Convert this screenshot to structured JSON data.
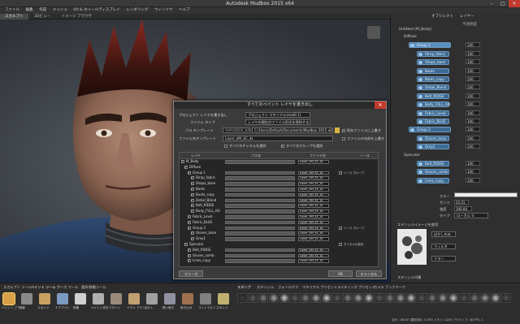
{
  "window": {
    "title": "Autodesk Mudbox 2015 x64",
    "min": "–",
    "max": "□",
    "close": "✕"
  },
  "menu": [
    "ファイル",
    "編集",
    "作成",
    "メッシュ",
    "UV & ホイールディスプレイ",
    "レンダリング",
    "ウィンドウ",
    "ヘルプ"
  ],
  "view_tabs": [
    "スカルプト",
    "3Dビュー",
    "イメージ ブラウザ"
  ],
  "right_panel": {
    "tabs": [
      "オブジェクト",
      "レイヤー"
    ],
    "col_header": "不透明度",
    "root": "Untitled (M_Body)",
    "items": [
      {
        "label": "Diffuse",
        "value": ""
      },
      {
        "label": "Group 1",
        "value": "100"
      },
      {
        "label": "Strap_fabric",
        "value": "100"
      },
      {
        "label": "Shape_base",
        "value": "100"
      },
      {
        "label": "Boots",
        "value": "100"
      },
      {
        "label": "Boots_copy",
        "value": "100"
      },
      {
        "label": "Detail_Blend",
        "value": "100"
      },
      {
        "label": "Belt_RIDGE",
        "value": "100"
      },
      {
        "label": "Body_FULL_AO",
        "value": "100"
      },
      {
        "label": "Fabric_Level",
        "value": "100"
      },
      {
        "label": "Fabric_BLUE",
        "value": "100"
      },
      {
        "label": "Group 2",
        "value": "100"
      },
      {
        "label": "Gloves_base",
        "value": "100"
      },
      {
        "label": "Grey1",
        "value": "100"
      },
      {
        "label": "Specular",
        "value": ""
      },
      {
        "label": "Belt_RIDGE",
        "value": "100"
      },
      {
        "label": "Gloves_comb",
        "value": "100"
      },
      {
        "label": "Lines_copy",
        "value": "100"
      }
    ],
    "props": {
      "color_label": "カラー",
      "gamma_label": "ガンマ",
      "gamma_value": "25.01",
      "opacity_label": "強度",
      "opacity_value": "100.00",
      "type_label": "タイプ",
      "type_value": "ローカル ①",
      "stencil_header": "ステンシルイメージを使用",
      "stencil_fields": [
        "ぼかしのみ",
        "フィルタ",
        "ミラー"
      ],
      "shortcut_header": "ステンシル付属"
    }
  },
  "dialog": {
    "title": "すべてのペイント レイヤを書き出し",
    "mesh_label": "プロジェクト レイヤを書き出し",
    "mesh_value": "プロジェクト マテリアル(mat0 1)",
    "file_type_label": "ファイル タイプ",
    "file_type_value": "レイヤの現在のファイル形式を保持する",
    "path_label": "パス テンプレート",
    "path_prefix": "%MUDBOX_BASE%",
    "path_value": "C:/Users/Default/Documents/Mudbox 2015 x64/Ma",
    "name_label": "ファイル名テンプレート",
    "name_value": "Layer_$M_$C_$L",
    "opt1": "既存ファイルに上書き",
    "opt2": "ファイルの名前を上書き",
    "opt3": "すべてのチャネルを選択",
    "opt4": "すべてのグループを選択",
    "cols": [
      "レイヤ",
      "パス名",
      "ファイル名",
      "ソース"
    ],
    "dd_value": "Layer_$M_$C_$L",
    "extra_text": "チャネルの変化",
    "extra_text2": "ソース グループ",
    "rows": [
      {
        "name": "M_Body",
        "indent": 0,
        "checked": true
      },
      {
        "name": "Diffuse",
        "indent": 1,
        "checked": true
      },
      {
        "name": "Group 1",
        "indent": 2,
        "checked": true
      },
      {
        "name": "Strap_fabric",
        "indent": 3,
        "checked": true
      },
      {
        "name": "Shape_base",
        "indent": 3,
        "checked": true
      },
      {
        "name": "Boots",
        "indent": 3,
        "checked": true
      },
      {
        "name": "Boots_copy",
        "indent": 3,
        "checked": true
      },
      {
        "name": "Detail_Blend",
        "indent": 3,
        "checked": true
      },
      {
        "name": "Belt_RIDGE",
        "indent": 3,
        "checked": true
      },
      {
        "name": "Body_FULL_AO",
        "indent": 3,
        "checked": true
      },
      {
        "name": "Fabric_Level",
        "indent": 2,
        "checked": true
      },
      {
        "name": "Fabric_BLUE",
        "indent": 2,
        "checked": true
      },
      {
        "name": "Group 2",
        "indent": 2,
        "checked": true
      },
      {
        "name": "Gloves_base",
        "indent": 3,
        "checked": true
      },
      {
        "name": "Grey1",
        "indent": 3,
        "checked": true
      },
      {
        "name": "Specular",
        "indent": 1,
        "checked": true
      },
      {
        "name": "Belt_RIDGE",
        "indent": 2,
        "checked": true
      },
      {
        "name": "Gloves_comb",
        "indent": 2,
        "checked": true
      },
      {
        "name": "Lines_copy",
        "indent": 2,
        "checked": true
      }
    ],
    "btn_left": "フリーズ",
    "btn_ok": "OK",
    "btn_cancel": "キャンセル"
  },
  "shelf": {
    "tabs": [
      "スカルプト ツール",
      "ペイント ツール",
      "ポーズ ツール",
      "選択/移動ツール"
    ],
    "tools": [
      "ペイント ブラシ",
      "投影",
      "スポンジ",
      "エアブラシ",
      "鉛筆",
      "ペイント消去",
      "クローン",
      "ドライ ブラシ",
      "ぼかし",
      "覆い焼き",
      "焼き込み",
      "コントラスト",
      "スポンジ"
    ],
    "stamp_tabs": [
      "スタンプ",
      "ステンシル",
      "フォールオフ",
      "マテリアル プリセット",
      "ライティング プリセット",
      "カメラ ブックマーク"
    ],
    "status": "合計 : 38167  選択済み: 0  GPU メモリ: 2203  アクティブ: 38  FPS: 1"
  },
  "colors": {
    "accent": "#3d6b94",
    "close": "#c43a2e"
  }
}
